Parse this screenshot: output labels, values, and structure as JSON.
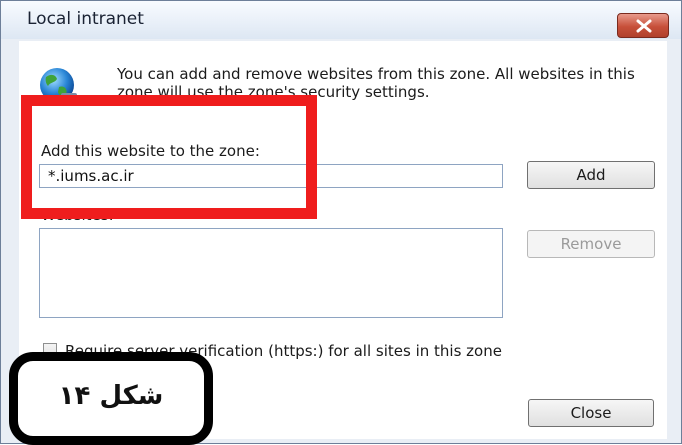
{
  "window": {
    "title": "Local intranet",
    "close_icon": "close-x-icon"
  },
  "info": {
    "icon": "globe-icon",
    "description": "You can add and remove websites from this zone. All websites in this zone will use the zone's security settings."
  },
  "add_site": {
    "label": "Add this website to the zone:",
    "value": "*.iums.ac.ir",
    "add_button": "Add"
  },
  "websites": {
    "label": "Websites:",
    "items": [],
    "remove_button": "Remove"
  },
  "verification": {
    "checked": false,
    "label": "Require server verification (https:) for all sites in this zone"
  },
  "footer": {
    "close_button": "Close"
  },
  "annotation": {
    "highlight_color": "#ef1d1d",
    "figure_label": "شکل ۱۴"
  }
}
